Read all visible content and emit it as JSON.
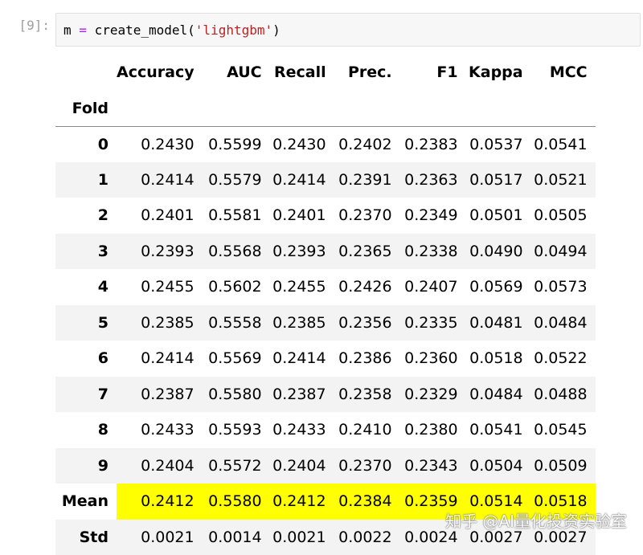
{
  "cell": {
    "prompt": "[9]:",
    "code_var": "m",
    "code_op": "=",
    "code_func": "create_model(",
    "code_arg": "'lightgbm'",
    "code_close": ")"
  },
  "table": {
    "columns": [
      "Accuracy",
      "AUC",
      "Recall",
      "Prec.",
      "F1",
      "Kappa",
      "MCC"
    ],
    "index_name": "Fold",
    "rows": [
      {
        "label": "0",
        "values": [
          "0.2430",
          "0.5599",
          "0.2430",
          "0.2402",
          "0.2383",
          "0.0537",
          "0.0541"
        ]
      },
      {
        "label": "1",
        "values": [
          "0.2414",
          "0.5579",
          "0.2414",
          "0.2391",
          "0.2363",
          "0.0517",
          "0.0521"
        ]
      },
      {
        "label": "2",
        "values": [
          "0.2401",
          "0.5581",
          "0.2401",
          "0.2370",
          "0.2349",
          "0.0501",
          "0.0505"
        ]
      },
      {
        "label": "3",
        "values": [
          "0.2393",
          "0.5568",
          "0.2393",
          "0.2365",
          "0.2338",
          "0.0490",
          "0.0494"
        ]
      },
      {
        "label": "4",
        "values": [
          "0.2455",
          "0.5602",
          "0.2455",
          "0.2426",
          "0.2407",
          "0.0569",
          "0.0573"
        ]
      },
      {
        "label": "5",
        "values": [
          "0.2385",
          "0.5558",
          "0.2385",
          "0.2356",
          "0.2335",
          "0.0481",
          "0.0484"
        ]
      },
      {
        "label": "6",
        "values": [
          "0.2414",
          "0.5569",
          "0.2414",
          "0.2386",
          "0.2360",
          "0.0518",
          "0.0522"
        ]
      },
      {
        "label": "7",
        "values": [
          "0.2387",
          "0.5580",
          "0.2387",
          "0.2358",
          "0.2329",
          "0.0484",
          "0.0488"
        ]
      },
      {
        "label": "8",
        "values": [
          "0.2433",
          "0.5593",
          "0.2433",
          "0.2410",
          "0.2380",
          "0.0541",
          "0.0545"
        ]
      },
      {
        "label": "9",
        "values": [
          "0.2404",
          "0.5572",
          "0.2404",
          "0.2370",
          "0.2343",
          "0.0504",
          "0.0509"
        ]
      },
      {
        "label": "Mean",
        "values": [
          "0.2412",
          "0.5580",
          "0.2412",
          "0.2384",
          "0.2359",
          "0.0514",
          "0.0518"
        ]
      },
      {
        "label": "Std",
        "values": [
          "0.0021",
          "0.0014",
          "0.0021",
          "0.0022",
          "0.0024",
          "0.0027",
          "0.0027"
        ]
      }
    ],
    "highlight_color": "#ffff00"
  },
  "watermark": "知乎 @AI量化投资实验室"
}
